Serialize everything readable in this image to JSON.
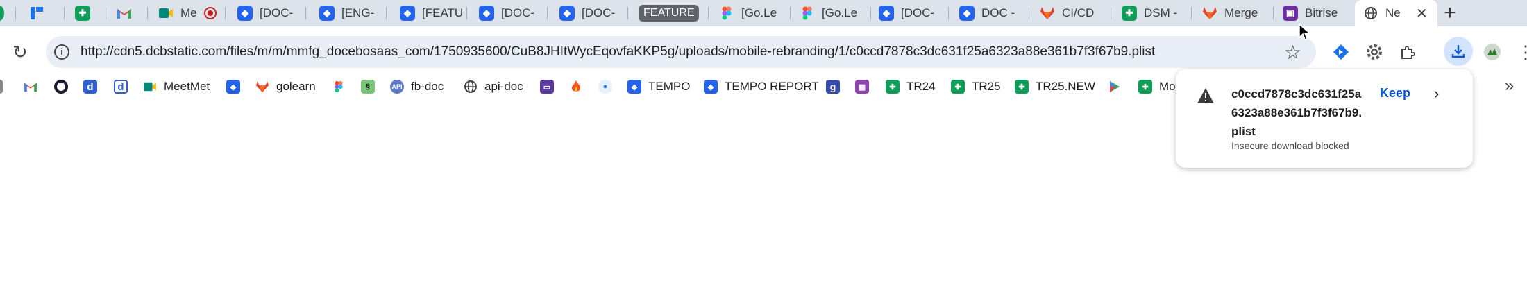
{
  "tabs": [
    {
      "label": "",
      "icon": "blue-app-icon",
      "color": "#1a73e8"
    },
    {
      "label": "",
      "icon": "sheets-icon",
      "color": "#0f9d58"
    },
    {
      "label": "",
      "icon": "gmail-icon",
      "color": "#ea4335"
    },
    {
      "label": "Me",
      "icon": "meet-icon",
      "color": "#00897b"
    },
    {
      "label": "[DOC-",
      "icon": "jira-icon",
      "color": "#2563eb"
    },
    {
      "label": "[ENG-",
      "icon": "jira-icon",
      "color": "#2563eb"
    },
    {
      "label": "[FEATU",
      "icon": "jira-icon",
      "color": "#2563eb"
    },
    {
      "label": "[DOC-",
      "icon": "jira-icon",
      "color": "#2563eb"
    },
    {
      "label": "[DOC-",
      "icon": "jira-icon",
      "color": "#2563eb"
    },
    {
      "label": "FEATURE",
      "icon": "none",
      "color": "#5f6368"
    },
    {
      "label": "[Go.Le",
      "icon": "figma-icon",
      "color": "#f24e1e"
    },
    {
      "label": "[Go.Le",
      "icon": "figma-icon",
      "color": "#f24e1e"
    },
    {
      "label": "[DOC-",
      "icon": "jira-icon",
      "color": "#2563eb"
    },
    {
      "label": "DOC -",
      "icon": "jira-icon",
      "color": "#2563eb"
    },
    {
      "label": "CI/CD",
      "icon": "gitlab-icon",
      "color": "#e24329"
    },
    {
      "label": "DSM -",
      "icon": "sheets-icon",
      "color": "#0f9d58"
    },
    {
      "label": "Merge",
      "icon": "gitlab-icon",
      "color": "#e24329"
    },
    {
      "label": "Bitrise",
      "icon": "bitrise-icon",
      "color": "#6b2fa0"
    },
    {
      "label": "Ne",
      "icon": "globe-icon",
      "color": "#444444",
      "active": true
    }
  ],
  "toolbar": {
    "url": "http://cdn5.dcbstatic.com/files/m/m/mmfg_docebosaas_com/1750935600/CuB8JHItWycEqovfaKKP5g/uploads/mobile-rebranding/1/c0ccd7878c3dc631f25a6323a88e361b7f3f67b9.plist"
  },
  "bookmarks": [
    {
      "label": "",
      "icon": "gmail-icon"
    },
    {
      "label": "",
      "icon": "circle-icon"
    },
    {
      "label": "",
      "icon": "d-icon"
    },
    {
      "label": "",
      "icon": "d-outline-icon"
    },
    {
      "label": "MeetMet",
      "icon": "meet-icon"
    },
    {
      "label": "",
      "icon": "jira-icon"
    },
    {
      "label": "golearn",
      "icon": "gitlab-icon"
    },
    {
      "label": "",
      "icon": "figma-icon"
    },
    {
      "label": "",
      "icon": "green-app-icon"
    },
    {
      "label": "fb-doc",
      "icon": "api-icon"
    },
    {
      "label": "api-doc",
      "icon": "globe-icon"
    },
    {
      "label": "",
      "icon": "purple-app-icon"
    },
    {
      "label": "",
      "icon": "fire-icon"
    },
    {
      "label": "",
      "icon": "apple-icon"
    },
    {
      "label": "TEMPO",
      "icon": "jira-icon"
    },
    {
      "label": "TEMPO REPORT",
      "icon": "jira-icon"
    },
    {
      "label": "",
      "icon": "g-icon"
    },
    {
      "label": "",
      "icon": "purple-pattern-icon"
    },
    {
      "label": "TR24",
      "icon": "sheets-icon"
    },
    {
      "label": "TR25",
      "icon": "sheets-icon"
    },
    {
      "label": "TR25.NEW",
      "icon": "sheets-icon"
    },
    {
      "label": "",
      "icon": "play-icon"
    },
    {
      "label": "Mo",
      "icon": "sheets-icon"
    }
  ],
  "download": {
    "filename": "c0ccd7878c3dc631f25a6323a88e361b7f3f67b9.plist",
    "status": "Insecure download blocked",
    "keep_label": "Keep"
  },
  "colors": {
    "tabstrip": "#dde3ea",
    "omnibox": "#e9eef6",
    "accent": "#0b57d0",
    "download_button": "#d3e3fd"
  }
}
